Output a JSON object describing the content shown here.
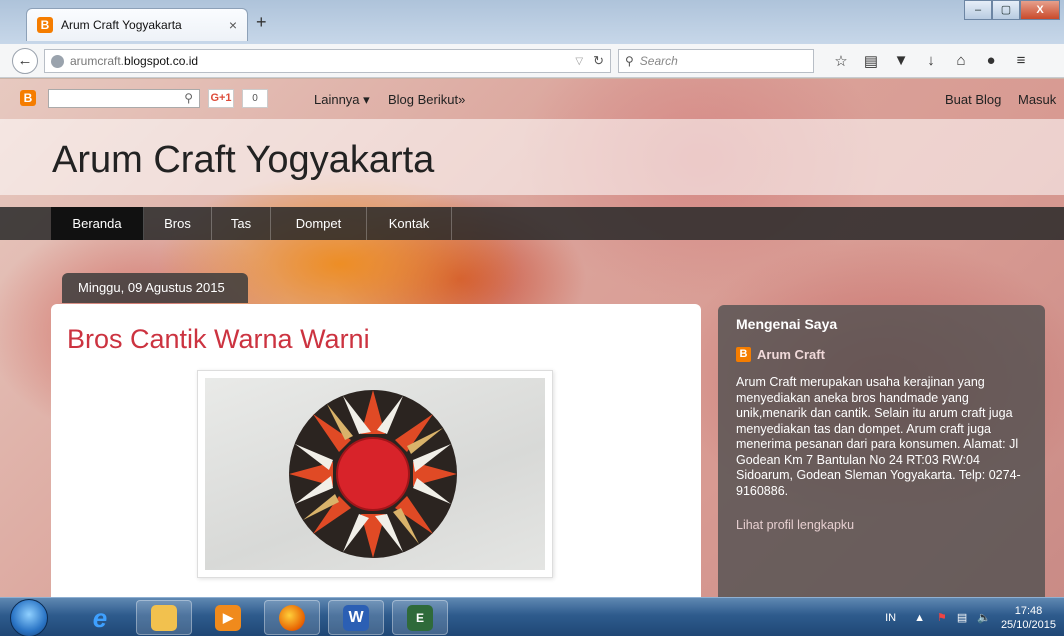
{
  "browser": {
    "tab_title": "Arum Craft Yogyakarta",
    "tab_close": "×",
    "new_tab": "+",
    "url_prefix": "arumcraft.",
    "url_domain": "blogspot.co.id",
    "search_placeholder": "Search",
    "window_min": "–",
    "window_max": "▢",
    "window_close": "X"
  },
  "bloggerbar": {
    "gplus_label": "G+1",
    "gplus_count": "0",
    "more_label": "Lainnya ▾",
    "next_blog": "Blog Berikut»",
    "create_blog": "Buat Blog",
    "sign_in": "Masuk"
  },
  "blog": {
    "title": "Arum Craft Yogyakarta",
    "nav": [
      "Beranda",
      "Bros",
      "Tas",
      "Dompet",
      "Kontak"
    ],
    "post_date": "Minggu, 09 Agustus 2015",
    "post_title": "Bros Cantik Warna Warni"
  },
  "sidebar": {
    "title": "Mengenai Saya",
    "profile_name": "Arum Craft",
    "description": "Arum Craft merupakan usaha kerajinan yang menyediakan aneka bros handmade yang unik,menarik dan cantik. Selain itu arum craft juga menyediakan tas dan dompet. Arum craft juga menerima pesanan dari para konsumen. Alamat: Jl Godean Km 7 Bantulan No 24 RT:03 RW:04 Sidoarum, Godean Sleman Yogyakarta. Telp: 0274-9160886.",
    "profile_link": "Lihat profil lengkapku"
  },
  "taskbar": {
    "language": "IN",
    "time": "17:48",
    "date": "25/10/2015",
    "apps": [
      "internet-explorer-icon",
      "file-explorer-icon",
      "media-player-icon",
      "firefox-icon",
      "word-icon",
      "esia-icon"
    ]
  },
  "colors": {
    "post_title": "#cc3340",
    "blogger_orange": "#f57d00",
    "nav_active": "#111111"
  }
}
